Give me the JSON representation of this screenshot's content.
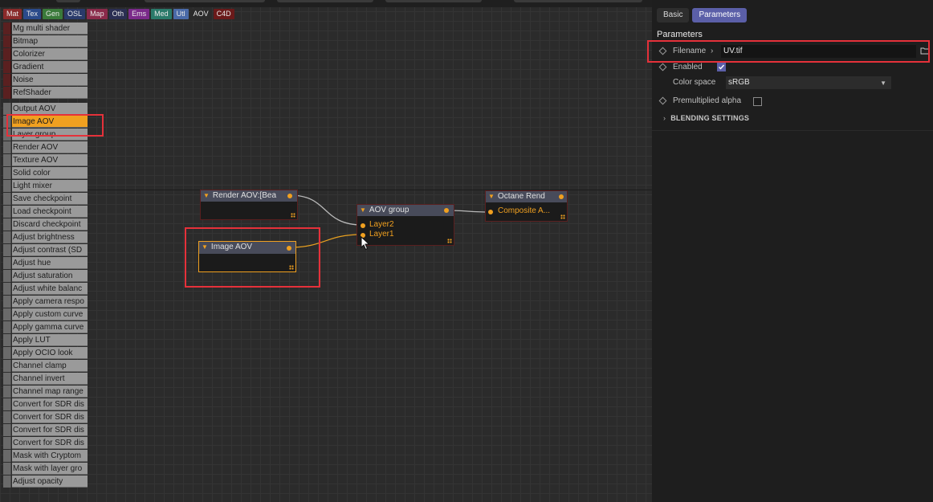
{
  "category_tabs": [
    {
      "label": "Mat",
      "color": "#8a2a2a"
    },
    {
      "label": "Tex",
      "color": "#2a4a8a"
    },
    {
      "label": "Gen",
      "color": "#3a7a3a"
    },
    {
      "label": "OSL",
      "color": "#2a3a6a"
    },
    {
      "label": "Map",
      "color": "#8a2a4a"
    },
    {
      "label": "Oth",
      "color": "#2a2e52"
    },
    {
      "label": "Ems",
      "color": "#7a2a8a"
    },
    {
      "label": "Med",
      "color": "#2a7a6a"
    },
    {
      "label": "Utl",
      "color": "#4a6aa8"
    },
    {
      "label": "AOV",
      "color": "#2b2b2b"
    },
    {
      "label": "C4D",
      "color": "#6a1a1a"
    }
  ],
  "node_list_top": [
    "Mg multi shader",
    "Bitmap",
    "Colorizer",
    "Gradient",
    "Noise",
    "RefShader"
  ],
  "node_list": [
    {
      "label": "Output AOV",
      "selected": false
    },
    {
      "label": "Image AOV",
      "selected": true
    },
    {
      "label": "Layer group",
      "selected": false
    },
    {
      "label": "Render AOV",
      "selected": false
    },
    {
      "label": "Texture AOV",
      "selected": false
    },
    {
      "label": "Solid color",
      "selected": false
    },
    {
      "label": "Light mixer",
      "selected": false
    },
    {
      "label": "Save checkpoint",
      "selected": false
    },
    {
      "label": "Load checkpoint",
      "selected": false
    },
    {
      "label": "Discard checkpoint",
      "selected": false
    },
    {
      "label": "Adjust brightness",
      "selected": false
    },
    {
      "label": "Adjust contrast (SD",
      "selected": false
    },
    {
      "label": "Adjust hue",
      "selected": false
    },
    {
      "label": "Adjust saturation",
      "selected": false
    },
    {
      "label": "Adjust white balanc",
      "selected": false
    },
    {
      "label": "Apply camera respo",
      "selected": false
    },
    {
      "label": "Apply custom curve",
      "selected": false
    },
    {
      "label": "Apply gamma curve",
      "selected": false
    },
    {
      "label": "Apply LUT",
      "selected": false
    },
    {
      "label": "Apply OCIO look",
      "selected": false
    },
    {
      "label": "Channel clamp",
      "selected": false
    },
    {
      "label": "Channel invert",
      "selected": false
    },
    {
      "label": "Channel map range",
      "selected": false
    },
    {
      "label": "Convert for SDR dis",
      "selected": false
    },
    {
      "label": "Convert for SDR dis",
      "selected": false
    },
    {
      "label": "Convert for SDR dis",
      "selected": false
    },
    {
      "label": "Convert for SDR dis",
      "selected": false
    },
    {
      "label": "Mask with Cryptom",
      "selected": false
    },
    {
      "label": "Mask with layer gro",
      "selected": false
    },
    {
      "label": "Adjust opacity",
      "selected": false
    }
  ],
  "nodes": {
    "render_aov": {
      "title": "Render AOV:[Bea"
    },
    "image_aov": {
      "title": "Image AOV"
    },
    "aov_group": {
      "title": "AOV group",
      "pin1": "Layer2",
      "pin2": "Layer1"
    },
    "octane_render": {
      "title": "Octane Rend",
      "pin1": "Composite A..."
    }
  },
  "panel": {
    "tabs": [
      {
        "label": "Basic",
        "active": false
      },
      {
        "label": "Parameters",
        "active": true
      }
    ],
    "title": "Parameters",
    "filename_label": "Filename",
    "filename_value": "UV.tif",
    "enabled_label": "Enabled",
    "enabled_checked": true,
    "color_space_label": "Color space",
    "color_space_value": "sRGB",
    "premult_label": "Premultiplied alpha",
    "premult_checked": false,
    "blending_label": "BLENDING SETTINGS"
  },
  "colors": {
    "accent": "#f0a020",
    "highlight": "#e5313a",
    "active_tab": "#5b5fa8"
  }
}
